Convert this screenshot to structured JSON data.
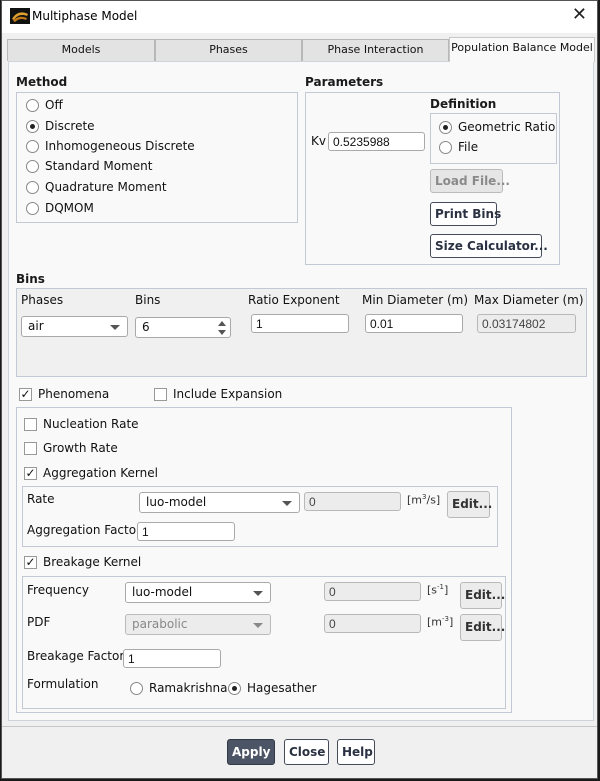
{
  "window": {
    "title": "Multiphase Model",
    "app_icon": "ansys-fluent-icon",
    "close_icon": "close-icon"
  },
  "tabs": [
    {
      "label": "Models",
      "active": false
    },
    {
      "label": "Phases",
      "active": false
    },
    {
      "label": "Phase Interaction",
      "active": false
    },
    {
      "label": "Population Balance Model",
      "active": true
    }
  ],
  "method": {
    "title": "Method",
    "options": [
      {
        "label": "Off",
        "selected": false
      },
      {
        "label": "Discrete",
        "selected": true
      },
      {
        "label": "Inhomogeneous Discrete",
        "selected": false
      },
      {
        "label": "Standard Moment",
        "selected": false
      },
      {
        "label": "Quadrature Moment",
        "selected": false
      },
      {
        "label": "DQMOM",
        "selected": false
      }
    ]
  },
  "parameters": {
    "title": "Parameters",
    "kv_label": "Kv",
    "kv_value": "0.5235988",
    "definition": {
      "title": "Definition",
      "options": [
        {
          "label": "Geometric Ratio",
          "selected": true
        },
        {
          "label": "File",
          "selected": false
        }
      ]
    },
    "load_file_label": "Load File...",
    "print_bins_label": "Print Bins",
    "size_calculator_label": "Size Calculator..."
  },
  "bins": {
    "title": "Bins",
    "phases_label": "Phases",
    "phases_value": "air",
    "bins_label": "Bins",
    "bins_value": "6",
    "ratio_exponent_label": "Ratio Exponent",
    "ratio_exponent_value": "1",
    "min_diameter_label": "Min Diameter (m)",
    "min_diameter_value": "0.01",
    "max_diameter_label": "Max Diameter (m)",
    "max_diameter_value": "0.03174802"
  },
  "phenomena": {
    "phenomena_label": "Phenomena",
    "phenomena_checked": true,
    "include_expansion_label": "Include Expansion",
    "include_expansion_checked": false,
    "nucleation_label": "Nucleation Rate",
    "nucleation_checked": false,
    "growth_label": "Growth Rate",
    "growth_checked": false,
    "aggregation": {
      "label": "Aggregation Kernel",
      "checked": true,
      "rate_label": "Rate",
      "rate_value": "luo-model",
      "rate_const": "0",
      "rate_unit_base": "[m",
      "rate_unit_sup": "3",
      "rate_unit_tail": "/s]",
      "edit_label": "Edit...",
      "factor_label": "Aggregation Factor",
      "factor_value": "1"
    },
    "breakage": {
      "label": "Breakage Kernel",
      "checked": true,
      "frequency_label": "Frequency",
      "frequency_value": "luo-model",
      "frequency_const": "0",
      "frequency_unit_base": "[s",
      "frequency_unit_sup": "-1",
      "frequency_unit_tail": "]",
      "pdf_label": "PDF",
      "pdf_value": "parabolic",
      "pdf_const": "0",
      "pdf_unit_base": "[m",
      "pdf_unit_sup": "-3",
      "pdf_unit_tail": "]",
      "edit_label": "Edit...",
      "factor_label": "Breakage Factor",
      "factor_value": "1",
      "formulation_label": "Formulation",
      "formulation_options": [
        {
          "label": "Ramakrishna",
          "selected": false
        },
        {
          "label": "Hagesather",
          "selected": true
        }
      ]
    }
  },
  "footer": {
    "apply_label": "Apply",
    "close_label": "Close",
    "help_label": "Help"
  }
}
